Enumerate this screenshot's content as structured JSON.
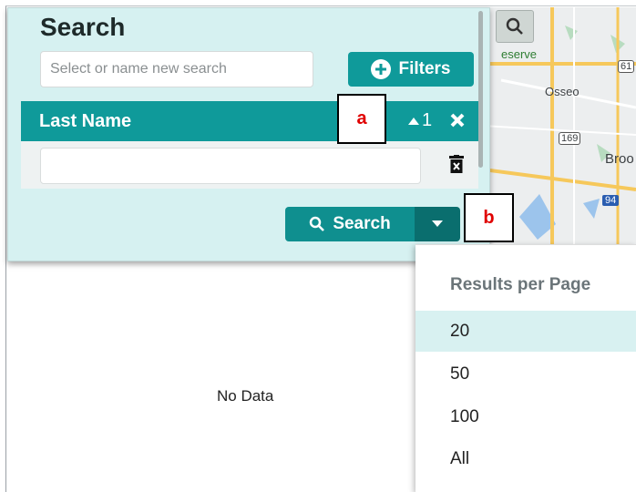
{
  "search_panel": {
    "title": "Search",
    "search_input_placeholder": "Select or name new search",
    "filters_button_label": "Filters",
    "filter": {
      "field_label": "Last Name",
      "sort_order": "1",
      "value": ""
    },
    "search_button_label": "Search"
  },
  "annotations": {
    "a": "a",
    "b": "b"
  },
  "results": {
    "empty_text": "No Data"
  },
  "results_per_page_menu": {
    "header": "Results per Page",
    "options": [
      "20",
      "50",
      "100",
      "All"
    ],
    "selected": "20"
  },
  "map": {
    "labels": [
      "eserve",
      "Osseo",
      "Broo",
      "169",
      "94",
      "61"
    ]
  },
  "colors": {
    "panel_bg": "#d6f1f1",
    "accent": "#0f9a9a",
    "accent_dark": "#0a6e6e",
    "annotation_text": "#e00000",
    "menu_selected": "#d8f1f1"
  }
}
